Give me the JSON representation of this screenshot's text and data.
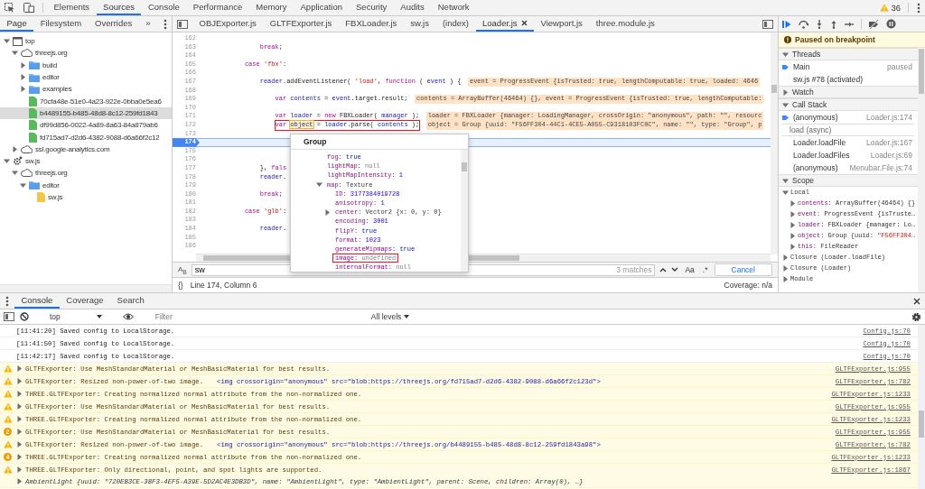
{
  "top_tabs": [
    {
      "label": "Elements",
      "selected": false
    },
    {
      "label": "Sources",
      "selected": true
    },
    {
      "label": "Console",
      "selected": false
    },
    {
      "label": "Performance",
      "selected": false
    },
    {
      "label": "Memory",
      "selected": false
    },
    {
      "label": "Application",
      "selected": false
    },
    {
      "label": "Security",
      "selected": false
    },
    {
      "label": "Audits",
      "selected": false
    },
    {
      "label": "Network",
      "selected": false
    }
  ],
  "warning_count": "36",
  "navigator": {
    "tabs": [
      {
        "label": "Page",
        "selected": true
      },
      {
        "label": "Filesystem",
        "selected": false
      },
      {
        "label": "Overrides",
        "selected": false
      }
    ],
    "more": "»",
    "tree": [
      {
        "label": "top",
        "kind": "frame",
        "expanded": true,
        "selected": false,
        "children": [
          {
            "label": "threejs.org",
            "kind": "domain",
            "expanded": true,
            "selected": false,
            "children": [
              {
                "label": "build",
                "kind": "folder",
                "expanded": false,
                "selected": false
              },
              {
                "label": "editor",
                "kind": "folder",
                "expanded": false,
                "selected": false
              },
              {
                "label": "examples",
                "kind": "folder",
                "expanded": false,
                "selected": false
              },
              {
                "label": "70cfa48e-51e0-4a23-922e-0bba0e5ea6",
                "kind": "file",
                "selected": false
              },
              {
                "label": "b4489155-b485-48d8-8c12-259fd1843",
                "kind": "file",
                "selected": true
              },
              {
                "label": "df99d856-0022-4a89-8a63-84a879ab6",
                "kind": "file",
                "selected": false
              },
              {
                "label": "fd715ad7-d2d6-4382-9088-d6a66f2c12",
                "kind": "file",
                "selected": false
              }
            ]
          },
          {
            "label": "ssl.google-analytics.com",
            "kind": "domain",
            "expanded": false,
            "selected": false
          }
        ]
      },
      {
        "label": "sw.js",
        "kind": "worker",
        "expanded": true,
        "selected": false,
        "children": [
          {
            "label": "threejs.org",
            "kind": "domain",
            "expanded": true,
            "selected": false,
            "children": [
              {
                "label": "editor",
                "kind": "folder",
                "expanded": true,
                "selected": false,
                "children": [
                  {
                    "label": "sw.js",
                    "kind": "script",
                    "selected": false
                  }
                ]
              }
            ]
          }
        ]
      }
    ]
  },
  "editor_tabs": [
    {
      "label": "OBJExporter.js",
      "selected": false
    },
    {
      "label": "GLTFExporter.js",
      "selected": false
    },
    {
      "label": "FBXLoader.js",
      "selected": false
    },
    {
      "label": "sw.js",
      "selected": false
    },
    {
      "label": "(index)",
      "selected": false
    },
    {
      "label": "Loader.js",
      "selected": true
    },
    {
      "label": "Viewport.js",
      "selected": false
    },
    {
      "label": "three.module.js",
      "selected": false
    }
  ],
  "code_lines": [
    {
      "num": "162",
      "paused": false
    },
    {
      "num": "163",
      "tokens": [
        {
          "text": "                break",
          "kind": "keyword"
        },
        {
          "text": ";",
          "kind": "plain"
        }
      ],
      "paused": false,
      "boxed": false
    },
    {
      "num": "164",
      "paused": false
    },
    {
      "num": "165",
      "tokens": [
        {
          "text": "            case ",
          "kind": "keyword"
        },
        {
          "text": "'fbx'",
          "kind": "string"
        },
        {
          "text": ":",
          "kind": "plain"
        }
      ],
      "paused": false,
      "boxed": false
    },
    {
      "num": "166",
      "paused": false
    },
    {
      "num": "167",
      "tokens": [
        {
          "text": "                reader",
          "kind": "variable"
        },
        {
          "text": ".addEventListener( ",
          "kind": "plain"
        },
        {
          "text": "'load'",
          "kind": "string"
        },
        {
          "text": ", ",
          "kind": "plain"
        },
        {
          "text": "function",
          "kind": "keyword"
        },
        {
          "text": " ( ",
          "kind": "plain"
        },
        {
          "text": "event",
          "kind": "variable"
        },
        {
          "text": " ) {",
          "kind": "plain"
        }
      ],
      "inline_value": "event = ProgressEvent {isTrusted: true, lengthComputable: true, loaded: 4646",
      "paused": false,
      "boxed": false
    },
    {
      "num": "168",
      "paused": false
    },
    {
      "num": "169",
      "tokens": [
        {
          "text": "                    var ",
          "kind": "keyword"
        },
        {
          "text": "contents",
          "kind": "variable"
        },
        {
          "text": " = ",
          "kind": "plain"
        },
        {
          "text": "event",
          "kind": "variable"
        },
        {
          "text": ".target.result;",
          "kind": "plain"
        }
      ],
      "inline_value": "contents = ArrayBuffer(46464) {}, event = ProgressEvent {isTrusted: true, lengthComputable:",
      "paused": false,
      "boxed": false
    },
    {
      "num": "170",
      "paused": false
    },
    {
      "num": "171",
      "tokens": [
        {
          "text": "                    var ",
          "kind": "keyword"
        },
        {
          "text": "loader",
          "kind": "variable"
        },
        {
          "text": " = ",
          "kind": "plain"
        },
        {
          "text": "new ",
          "kind": "keyword"
        },
        {
          "text": "FBXLoader( ",
          "kind": "plain"
        },
        {
          "text": "manager",
          "kind": "variable"
        },
        {
          "text": " );",
          "kind": "plain"
        }
      ],
      "inline_value": "loader = FBXLoader {manager: LoadingManager, crossOrigin: \"anonymous\", path: \"\", resourc",
      "paused": false,
      "boxed": false
    },
    {
      "num": "172",
      "tokens": [
        {
          "text": "                    var ",
          "kind": "keyword"
        },
        {
          "text": "object",
          "kind": "hover"
        },
        {
          "text": " = ",
          "kind": "plain"
        },
        {
          "text": "loader",
          "kind": "variable"
        },
        {
          "text": ".parse( ",
          "kind": "plain"
        },
        {
          "text": "contents",
          "kind": "variable"
        },
        {
          "text": " );",
          "kind": "plain"
        }
      ],
      "inline_value": "object = Group {uuid: \"F56FF304-44C1-4CE5-A055-C9318103FC0C\", name: \"\", type: \"Group\", p",
      "paused": false,
      "boxed": true
    },
    {
      "num": "173",
      "paused": false
    },
    {
      "num": "174",
      "paused": true
    },
    {
      "num": "175",
      "paused": false
    },
    {
      "num": "176",
      "paused": false
    },
    {
      "num": "177",
      "tokens": [
        {
          "text": "                }, ",
          "kind": "plain"
        },
        {
          "text": "fals",
          "kind": "keyword"
        }
      ],
      "paused": false,
      "boxed": false
    },
    {
      "num": "178",
      "tokens": [
        {
          "text": "                reader",
          "kind": "variable"
        },
        {
          "text": ".",
          "kind": "plain"
        }
      ],
      "paused": false,
      "boxed": false
    },
    {
      "num": "179",
      "paused": false
    },
    {
      "num": "180",
      "tokens": [
        {
          "text": "                break",
          "kind": "keyword"
        },
        {
          "text": ";",
          "kind": "plain"
        }
      ],
      "paused": false,
      "boxed": false
    },
    {
      "num": "181",
      "paused": false
    },
    {
      "num": "182",
      "tokens": [
        {
          "text": "            case ",
          "kind": "keyword"
        },
        {
          "text": "'glb'",
          "kind": "string"
        },
        {
          "text": ":",
          "kind": "plain"
        }
      ],
      "paused": false,
      "boxed": false
    },
    {
      "num": "183",
      "paused": false
    },
    {
      "num": "184",
      "tokens": [
        {
          "text": "                reader",
          "kind": "variable"
        },
        {
          "text": ".",
          "kind": "plain"
        }
      ],
      "paused": false,
      "boxed": false
    },
    {
      "num": "185",
      "paused": false
    },
    {
      "num": "186",
      "paused": false
    }
  ],
  "popup": {
    "title": "Group",
    "properties": [
      {
        "key": "fog:",
        "value": "true",
        "kind": "boolean",
        "boxed": false
      },
      {
        "key": "lightMap:",
        "value": "null",
        "kind": "null",
        "boxed": false
      },
      {
        "key": "lightMapIntensity:",
        "value": "1",
        "kind": "number",
        "boxed": false
      },
      {
        "key": "map:",
        "value": "Texture",
        "kind": "object",
        "expanded": true,
        "boxed": false,
        "children": [
          {
            "key": "ID:",
            "value": "3177384019728",
            "kind": "number",
            "boxed": false
          },
          {
            "key": "anisotropy:",
            "value": "1",
            "kind": "number",
            "boxed": false
          },
          {
            "key": "center:",
            "value": "Vector2 {x: 0, y: 0}",
            "kind": "object",
            "expanded": false,
            "boxed": false
          },
          {
            "key": "encoding:",
            "value": "3001",
            "kind": "number",
            "boxed": false
          },
          {
            "key": "flipY:",
            "value": "true",
            "kind": "boolean",
            "boxed": false
          },
          {
            "key": "format:",
            "value": "1023",
            "kind": "number",
            "boxed": false
          },
          {
            "key": "generateMipmaps:",
            "value": "true",
            "kind": "boolean",
            "boxed": false
          },
          {
            "key": "image:",
            "value": "undefined",
            "kind": "undefined",
            "boxed": true
          },
          {
            "key": "internalFormat:",
            "value": "null",
            "kind": "null",
            "boxed": false
          }
        ]
      }
    ]
  },
  "find": {
    "toggle": "A$_{B}$",
    "value": "sw",
    "matches": "3 matches",
    "case_option": "Aa",
    "regex_option": ".*",
    "cancel": "Cancel"
  },
  "status": {
    "format": "{}",
    "position": "Line 174, Column 6",
    "coverage": "Coverage: n/a"
  },
  "debugger": {
    "banner": "Paused on breakpoint",
    "threads": {
      "title": "Threads",
      "expanded": true,
      "items": [
        {
          "name": "Main",
          "status": "paused",
          "current": true
        },
        {
          "name": "sw.js #78 (activated)",
          "current": false
        }
      ]
    },
    "watch": {
      "title": "Watch",
      "expanded": false
    },
    "call_stack": {
      "title": "Call Stack",
      "expanded": true,
      "frames": [
        {
          "kind": "frame",
          "name": "(anonymous)",
          "location": "Loader.js:174",
          "current": true
        },
        {
          "kind": "async",
          "name": "load (async)"
        },
        {
          "kind": "frame",
          "name": "Loader.loadFile",
          "location": "Loader.js:167",
          "current": false
        },
        {
          "kind": "frame",
          "name": "Loader.loadFiles",
          "location": "Loader.js:69",
          "current": false
        },
        {
          "kind": "frame",
          "name": "(anonymous)",
          "location": "Menubar.File.js:74",
          "current": false
        }
      ]
    },
    "scope": {
      "title": "Scope",
      "expanded": true,
      "scopes": [
        {
          "name": "Local",
          "expanded": true,
          "vars": [
            {
              "key": "contents:",
              "value": "ArrayBuffer(46464) {}"
            },
            {
              "key": "event:",
              "value": "ProgressEvent {isTruste…"
            },
            {
              "key": "loader:",
              "value": "FBXLoader {manager: Lo…"
            },
            {
              "key": "object:",
              "value": "Group {uuid: ",
              "string": "\"F56FF304…"
            },
            {
              "key": "this:",
              "value": "FileReader"
            }
          ]
        },
        {
          "name": "Closure (Loader.loadFile)",
          "expanded": false
        },
        {
          "name": "Closure (Loader)",
          "expanded": false
        },
        {
          "name": "Module",
          "expanded": false
        }
      ]
    }
  },
  "drawer": {
    "tabs": [
      {
        "label": "Console",
        "selected": true
      },
      {
        "label": "Coverage",
        "selected": false
      },
      {
        "label": "Search",
        "selected": false
      }
    ],
    "context": "top",
    "filter_placeholder": "Filter",
    "levels": "All levels",
    "messages": [
      {
        "kind": "log",
        "text": "[11:41:20] Saved config to LocalStorage.",
        "source": "Config.js:70"
      },
      {
        "kind": "log",
        "text": "[11:41:50] Saved config to LocalStorage.",
        "source": "Config.js:70"
      },
      {
        "kind": "log",
        "text": "[11:42:17] Saved config to LocalStorage.",
        "source": "Config.js:70"
      },
      {
        "kind": "warning",
        "text": "GLTFExporter: Use MeshStandardMaterial or MeshBasicMaterial for best results.",
        "source": "GLTFExporter.js:955"
      },
      {
        "kind": "warning",
        "text": "GLTFExporter: Resized non-power-of-two image.",
        "element": "<img crossorigin=\"anonymous\" src=\"blob:https://threejs.org/fd715ad7-d2d6-4382-9088-d6a66f2c123d\">",
        "source": "GLTFExporter.js:782"
      },
      {
        "kind": "warning",
        "text": "THREE.GLTFExporter: Creating normalized normal attribute from the non-normalized one.",
        "source": "GLTFExporter.js:1233"
      },
      {
        "kind": "warning",
        "text": "GLTFExporter: Use MeshStandardMaterial or MeshBasicMaterial for best results.",
        "source": "GLTFExporter.js:955"
      },
      {
        "kind": "warning",
        "text": "THREE.GLTFExporter: Creating normalized normal attribute from the non-normalized one.",
        "source": "GLTFExporter.js:1233"
      },
      {
        "kind": "warning",
        "count": "2",
        "text": "GLTFExporter: Use MeshStandardMaterial or MeshBasicMaterial for best results.",
        "source": "GLTFExporter.js:955"
      },
      {
        "kind": "warning",
        "text": "GLTFExporter: Resized non-power-of-two image.",
        "element": "<img crossorigin=\"anonymous\" src=\"blob:https://threejs.org/b4489155-b485-48d8-8c12-259fd1843a98\">",
        "source": "GLTFExporter.js:782"
      },
      {
        "kind": "warning",
        "count": "4",
        "text": "THREE.GLTFExporter: Creating normalized normal attribute from the non-normalized one.",
        "source": "GLTFExporter.js:1233"
      },
      {
        "kind": "warning",
        "text": "THREE.GLTFExporter: Only directional, point, and spot lights are supported.",
        "source": "GLTFExporter.js:1867",
        "detail": "AmbientLight {uuid: \"720EB3CE-38F3-4EF5-A39E-5D2AC4E3DB3D\", name: \"AmbientLight\", type: \"AmbientLight\", parent: Scene, children: Array(0), …}"
      }
    ]
  }
}
